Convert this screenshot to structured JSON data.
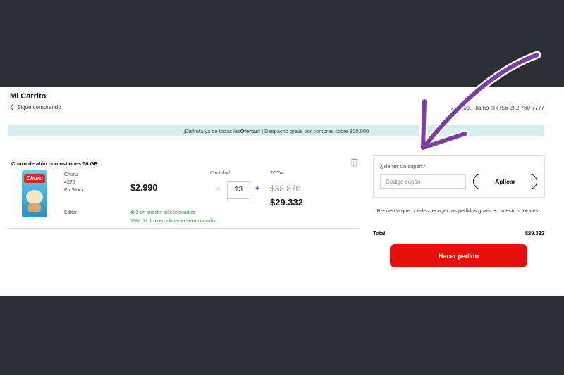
{
  "header": {
    "title": "Mi Carrito",
    "back_label": "Sigue comprando",
    "help_prefix": "¿",
    "help_text": "lamos?",
    "help_phone": "llama al (+56 2) 2 760 7777"
  },
  "banner": {
    "prefix": "¡Disfruta ya de todas las ",
    "bold": "Ofertas",
    "suffix": "! | Despacho gratis por compras sobre $20.000"
  },
  "cart": {
    "item": {
      "name": "Churu de atún con ostiones 56 GR",
      "brand": "Churu",
      "sku": "4278",
      "stock": "En Stock",
      "edit_label": "Editar",
      "thumb_logo": "Churu",
      "unit_price": "$2.990",
      "promos": [
        "4x3 en snacks seleccionados.",
        "19% de dcto en alimento seleccionado."
      ],
      "quantity_label": "Cantidad",
      "quantity": "13",
      "minus": "-",
      "plus": "+",
      "total_label": "TOTAL",
      "old_total": "$38.870",
      "new_total": "$29.332"
    }
  },
  "summary": {
    "coupon_question": "¿Tienes un cupón?",
    "coupon_placeholder": "Código cupón",
    "apply_label": "Aplicar",
    "pickup_note": "Recuerda que puedes recoger tus pedidos gratis en nuestros locales.",
    "total_label": "Total",
    "total_value": "$29.332",
    "order_button": "Hacer pedido"
  },
  "colors": {
    "background": "#2b2e33",
    "banner": "#d6eef2",
    "order_button": "#e5120c",
    "promo_text": "#2e9b3b",
    "arrow": "#7b3fa0"
  },
  "icons": [
    "chevron-left-icon",
    "trash-icon",
    "arrow-annotation-icon"
  ]
}
